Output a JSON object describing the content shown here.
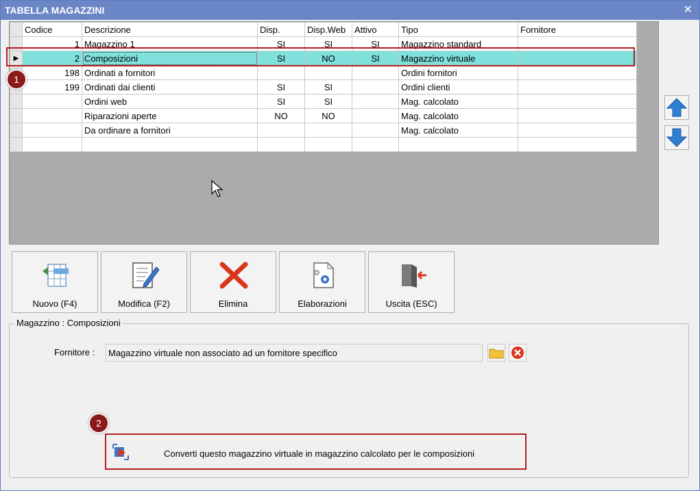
{
  "window": {
    "title": "TABELLA MAGAZZINI",
    "close_label": "✕"
  },
  "grid": {
    "columns": [
      "Codice",
      "Descrizione",
      "Disp.",
      "Disp.Web",
      "Attivo",
      "Tipo",
      "Fornitore"
    ],
    "rows": [
      {
        "codice": "1",
        "descrizione": "Magazzino 1",
        "disp": "SI",
        "dispweb": "SI",
        "attivo": "SI",
        "tipo": "Magazzino standard",
        "fornitore": ""
      },
      {
        "codice": "2",
        "descrizione": "Composizioni",
        "disp": "SI",
        "dispweb": "NO",
        "attivo": "SI",
        "tipo": "Magazzino virtuale",
        "fornitore": "",
        "selected": true
      },
      {
        "codice": "198",
        "descrizione": "Ordinati a fornitori",
        "disp": "",
        "dispweb": "",
        "attivo": "",
        "tipo": "Ordini fornitori",
        "fornitore": ""
      },
      {
        "codice": "199",
        "descrizione": "Ordinati dai clienti",
        "disp": "SI",
        "dispweb": "SI",
        "attivo": "",
        "tipo": "Ordini clienti",
        "fornitore": ""
      },
      {
        "codice": "",
        "descrizione": "Ordini web",
        "disp": "SI",
        "dispweb": "SI",
        "attivo": "",
        "tipo": "Mag. calcolato",
        "fornitore": ""
      },
      {
        "codice": "",
        "descrizione": "Riparazioni aperte",
        "disp": "NO",
        "dispweb": "NO",
        "attivo": "",
        "tipo": "Mag. calcolato",
        "fornitore": ""
      },
      {
        "codice": "",
        "descrizione": "Da ordinare a fornitori",
        "disp": "",
        "dispweb": "",
        "attivo": "",
        "tipo": "Mag. calcolato",
        "fornitore": ""
      },
      {
        "codice": "",
        "descrizione": "",
        "disp": "",
        "dispweb": "",
        "attivo": "",
        "tipo": "",
        "fornitore": ""
      }
    ],
    "selection_color": "#7fe0dc"
  },
  "badges": {
    "one": "1",
    "two": "2"
  },
  "toolbar": {
    "nuovo": "Nuovo (F4)",
    "modifica": "Modifica (F2)",
    "elimina": "Elimina",
    "elaborazioni": "Elaborazioni",
    "uscita": "Uscita (ESC)"
  },
  "detail": {
    "group_title": "Magazzino : Composizioni",
    "fornitore_label": "Fornitore :",
    "fornitore_value": "Magazzino virtuale non associato ad un fornitore specifico",
    "convert_label": "Converti questo magazzino virtuale in magazzino calcolato per le composizioni"
  },
  "icons": [
    "up-arrow-icon",
    "down-arrow-icon",
    "new-table-icon",
    "edit-document-icon",
    "delete-x-icon",
    "gear-document-icon",
    "exit-door-icon",
    "folder-icon",
    "clear-icon",
    "convert-icon"
  ],
  "colors": {
    "title_bar": "#6b86c6",
    "highlight": "#b01d22",
    "badge": "#8b1a1a"
  }
}
